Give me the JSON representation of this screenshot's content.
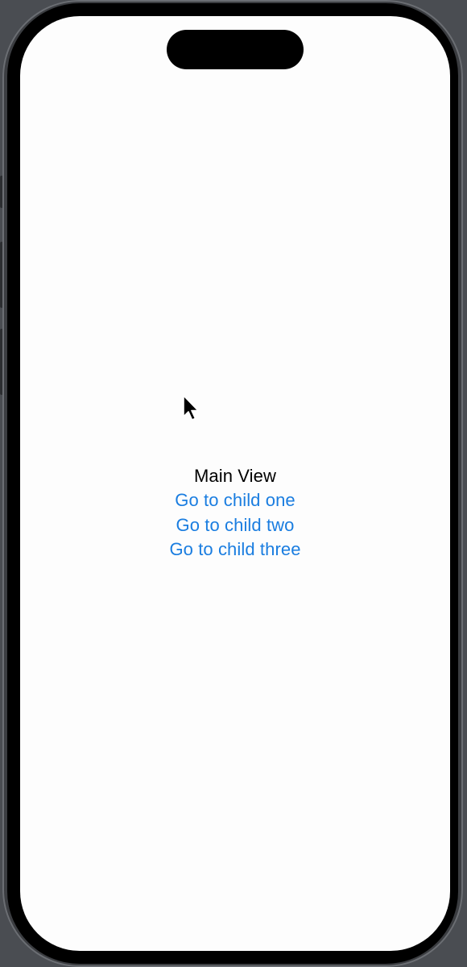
{
  "screen": {
    "title": "Main View",
    "links": [
      {
        "label": "Go to child one"
      },
      {
        "label": "Go to child two"
      },
      {
        "label": "Go to child three"
      }
    ]
  },
  "colors": {
    "link": "#1a7de0",
    "text": "#000000",
    "background": "#fdfdfd"
  },
  "icons": {
    "pointer": "mouse-pointer-icon"
  }
}
